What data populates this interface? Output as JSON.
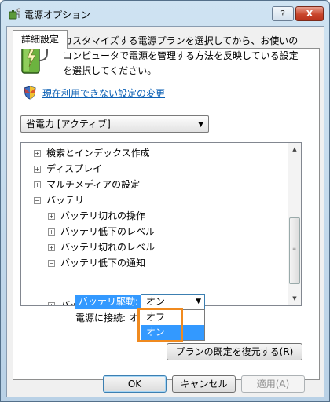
{
  "window": {
    "title": "電源オプション",
    "help_label": "?",
    "close_label": "X"
  },
  "tab": {
    "label": "詳細設定"
  },
  "description": "カスタマイズする電源プランを選択してから、お使いの\nコンピュータで電源を管理する方法を反映している設定\nを選択してください。",
  "change_link": "現在利用できない設定の変更",
  "plan_select": {
    "value": "省電力 [アクティブ]"
  },
  "tree": [
    {
      "label": "検索とインデックス作成",
      "expander": "+"
    },
    {
      "label": "ディスプレイ",
      "expander": "+"
    },
    {
      "label": "マルチメディアの設定",
      "expander": "+"
    },
    {
      "label": "バッテリ",
      "expander": "−"
    },
    {
      "label": "バッテリ切れの操作",
      "expander": "+"
    },
    {
      "label": "バッテリ低下のレベル",
      "expander": "+"
    },
    {
      "label": "バッテリ切れのレベル",
      "expander": "+"
    },
    {
      "label": "バッテリ低下の通知",
      "expander": "−"
    },
    {
      "label": "バッテリ低下の操",
      "expander": "+"
    }
  ],
  "battery_setting": {
    "label": "バッテリ駆動:",
    "value": "オン",
    "ac_label": "電源に接続:",
    "ac_value": "オ"
  },
  "dropdown_options": [
    "オフ",
    "オン"
  ],
  "restore_button": "プランの既定を復元する(R)",
  "buttons": {
    "ok": "OK",
    "cancel": "キャンセル",
    "apply": "適用(A)"
  },
  "colors": {
    "selection": "#3399ff",
    "highlight_border": "#f08a1f",
    "link": "#0a5fb4"
  }
}
